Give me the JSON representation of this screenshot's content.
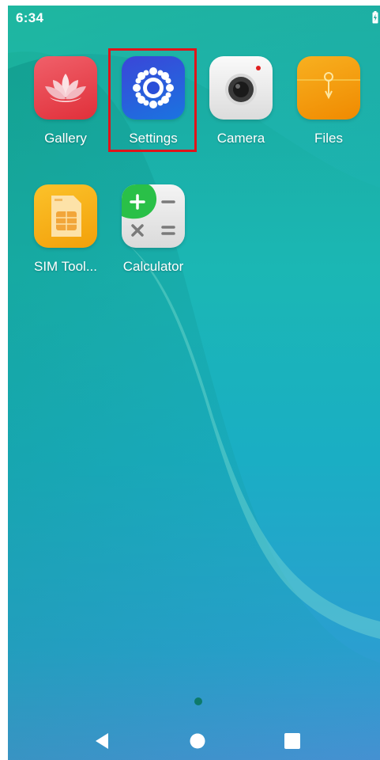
{
  "status_bar": {
    "time": "6:34",
    "battery_icon": "battery-charging-icon"
  },
  "apps": [
    {
      "label": "Gallery",
      "icon": "lotus-icon",
      "color": "#e8404a"
    },
    {
      "label": "Settings",
      "icon": "gear-icon",
      "color": "#2f4fd6"
    },
    {
      "label": "Camera",
      "icon": "camera-icon",
      "color": "#f2f2f2"
    },
    {
      "label": "Files",
      "icon": "folder-icon",
      "color": "#f5a20c"
    },
    {
      "label": "SIM Tool...",
      "icon": "sim-card-icon",
      "color": "#f7b516"
    },
    {
      "label": "Calculator",
      "icon": "calculator-icon",
      "color": "#ececec"
    }
  ],
  "highlight": {
    "target": "Settings",
    "color": "#e0141a"
  },
  "page_indicator": {
    "current": 1,
    "total": 1
  },
  "nav_bar": {
    "back": "back-triangle-icon",
    "home": "home-circle-icon",
    "recents": "recents-square-icon"
  }
}
